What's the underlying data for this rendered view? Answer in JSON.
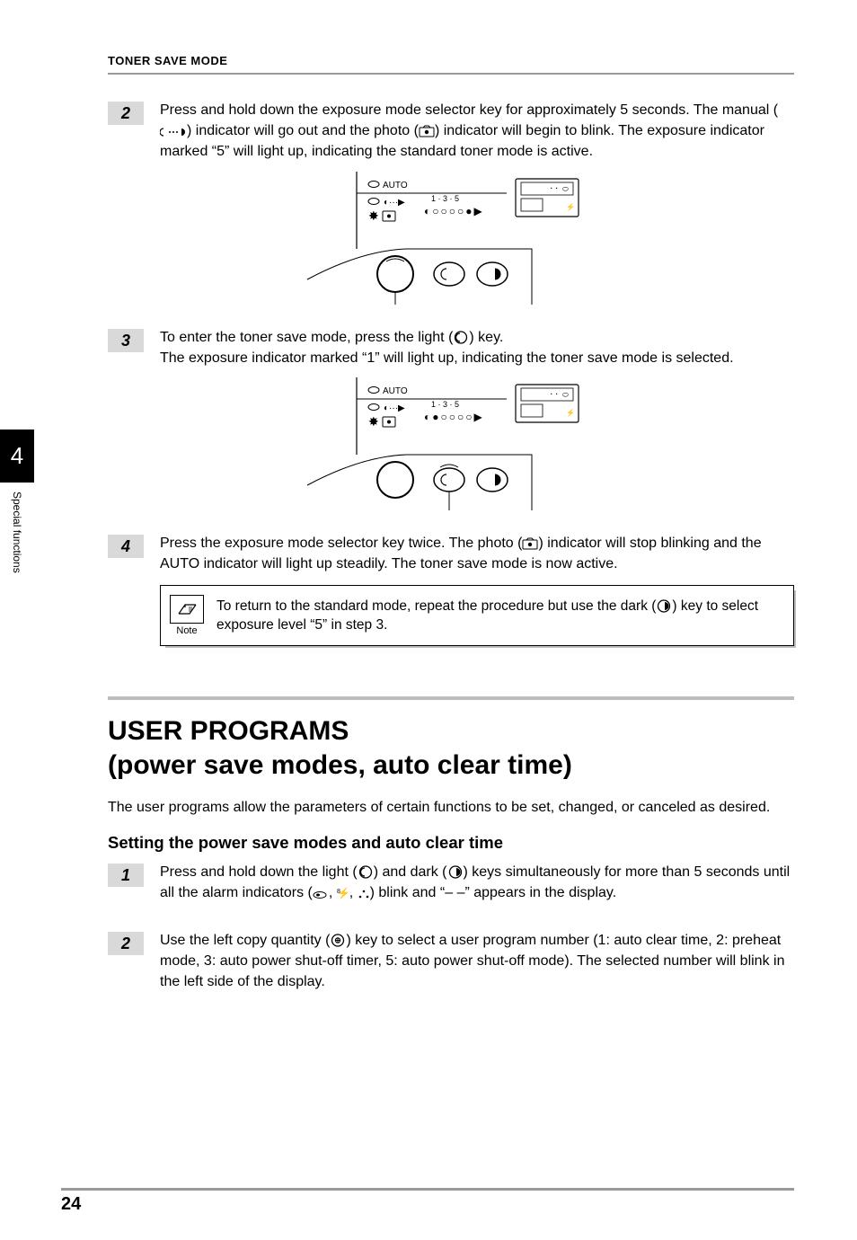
{
  "running_head": "TONER SAVE MODE",
  "side_tab": {
    "chapter": "4",
    "label": "Special functions"
  },
  "page_number": "24",
  "steps_top": [
    {
      "num": "2",
      "html": "Press and hold down the exposure mode selector key for approximately 5 seconds. The manual ({MANUAL}) indicator will go out and the photo ({PHOTO}) indicator will begin to blink. The exposure indicator marked “5” will light up, indicating the standard toner mode is active."
    },
    {
      "num": "3",
      "html": "To enter the toner save mode, press the light ({LIGHT}) key.\nThe exposure indicator marked “1” will light up, indicating the toner save mode is selected."
    },
    {
      "num": "4",
      "html": "Press the exposure mode selector key twice. The photo ({PHOTO}) indicator will stop blinking and the AUTO indicator will light up steadily. The toner save mode is now active."
    }
  ],
  "note": {
    "label": "Note",
    "text": "To return to the standard mode, repeat the procedure but use the dark ({DARK}) key to select exposure level “5” in step 3."
  },
  "section": {
    "title": "USER PROGRAMS",
    "subtitle": "(power save modes, auto clear time)",
    "intro": "The user programs allow the parameters of certain functions to be set, changed, or canceled as desired.",
    "subhead": "Setting the power save modes and auto clear time"
  },
  "steps_bottom": [
    {
      "num": "1",
      "html": "Press and hold down the light ({LIGHT}) and dark ({DARK}) keys simultaneously for more than 5 seconds until all the alarm indicators ({ALARM1}, {ALARM2}, {ALARM3}) blink and “– –” appears in the display."
    },
    {
      "num": "2",
      "html": "Use the left copy quantity ({COPYQTY}) key to select a user program number (1: auto clear time, 2: preheat mode, 3: auto power shut-off timer, 5: auto power shut-off mode). The selected number will blink in the left side of the display."
    }
  ],
  "panel": {
    "auto_label": "AUTO",
    "scale": "1 · 3 · 5"
  }
}
